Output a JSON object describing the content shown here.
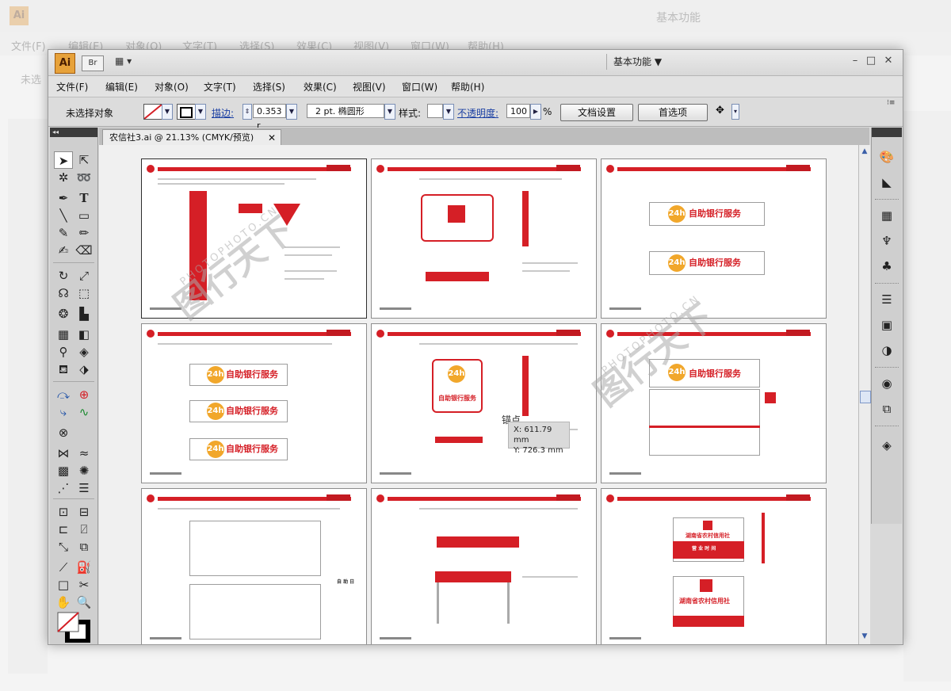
{
  "background_app": {
    "logo": "Ai",
    "workspace": "基本功能",
    "menu": [
      "文件(F)",
      "编辑(E)",
      "对象(O)",
      "文字(T)",
      "选择(S)",
      "效果(C)",
      "视图(V)",
      "窗口(W)",
      "帮助(H)"
    ],
    "selection_label": "未选"
  },
  "window": {
    "logo": "Ai",
    "bridge_label": "Br",
    "arrange_label": "▦ ▾",
    "workspace": "基本功能 ▼",
    "controls": [
      "–",
      "□",
      "✕"
    ]
  },
  "menubar": [
    "文件(F)",
    "编辑(E)",
    "对象(O)",
    "文字(T)",
    "选择(S)",
    "效果(C)",
    "视图(V)",
    "窗口(W)",
    "帮助(H)"
  ],
  "control_bar": {
    "selection": "未选择对象",
    "stroke_label": "描边:",
    "stroke_value": "0.353 r",
    "brush": "2 pt. 椭圆形",
    "style_label": "样式:",
    "opacity_label": "不透明度:",
    "opacity_value": "100",
    "opacity_unit": "%",
    "doc_setup": "文档设置",
    "preferences": "首选项"
  },
  "document_tab": {
    "title": "农信社3.ai @ 21.13% (CMYK/预览)",
    "close": "✕"
  },
  "cursor_info": {
    "anchor": "锚点",
    "x": "X: 611.79 mm",
    "y": "Y: 726.3 mm"
  },
  "sign_texts": {
    "self_service": "自助银行服务",
    "badge": "24h",
    "bank_name": "湖南省农村信用社",
    "hours_title": "营 业 时 间",
    "holiday": "自 助 日"
  },
  "watermark": {
    "main": "图行天下",
    "sub": "PHOTOPHOTO.CN"
  },
  "tools": [
    "selection-tool",
    "direct-selection-tool",
    "magic-wand-tool",
    "lasso-tool",
    "pen-tool",
    "type-tool",
    "line-tool",
    "rectangle-tool",
    "paintbrush-tool",
    "pencil-tool",
    "blob-brush-tool",
    "eraser-tool",
    "rotate-tool",
    "scale-tool",
    "warp-tool",
    "free-transform-tool",
    "symbol-sprayer-tool",
    "column-graph-tool",
    "mesh-tool",
    "gradient-tool",
    "eyedropper-tool",
    "blend-tool",
    "live-paint-bucket-tool",
    "live-paint-selection-tool",
    "artboard-tool",
    "slice-tool",
    "hand-tool",
    "zoom-tool"
  ]
}
